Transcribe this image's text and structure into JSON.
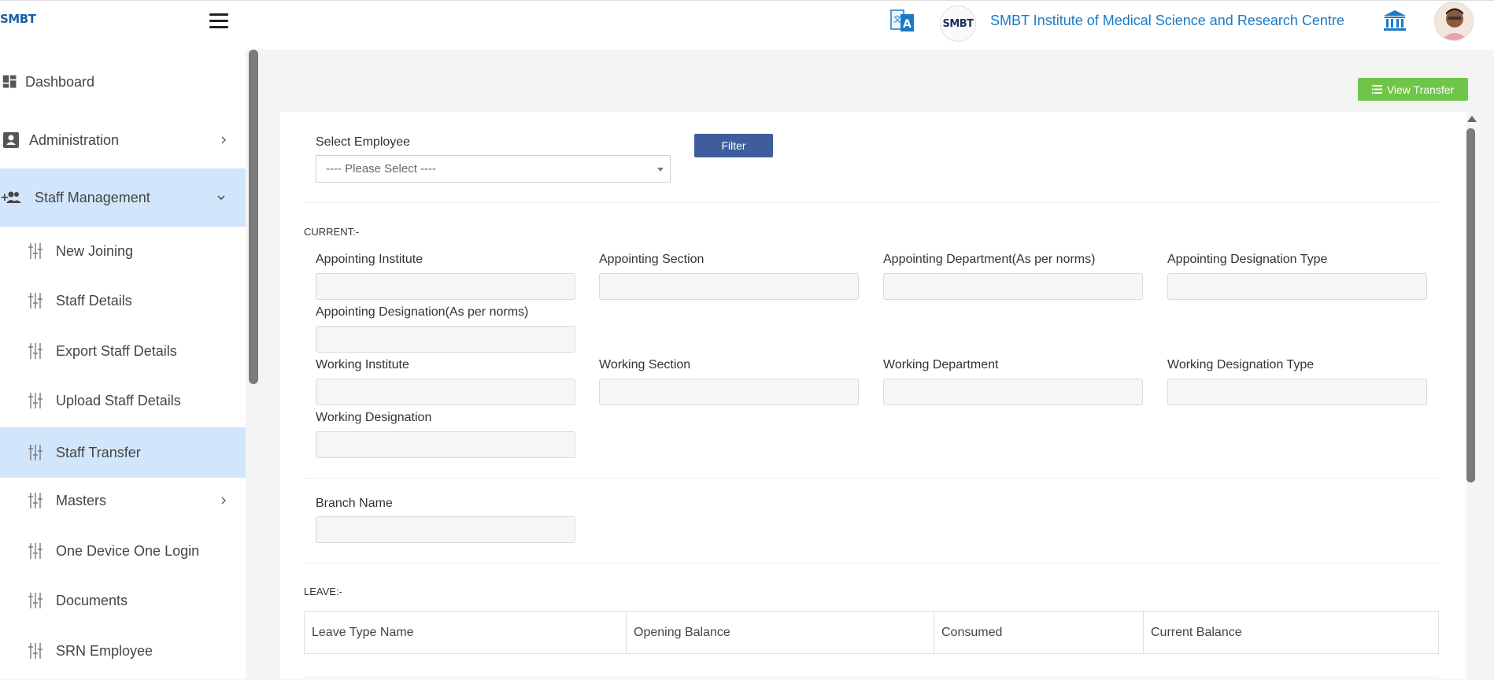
{
  "header": {
    "logo_text": "SMBT",
    "institute_logo_text": "SMBT",
    "institute_name": "SMBT Institute of Medical Science and Research Centre"
  },
  "sidebar": {
    "items": [
      {
        "label": "Dashboard",
        "icon": "dashboard-icon"
      },
      {
        "label": "Administration",
        "icon": "id-badge-icon"
      },
      {
        "label": "Staff Management",
        "icon": "people-add-icon"
      },
      {
        "label": "New Joining",
        "icon": "sliders-icon"
      },
      {
        "label": "Staff Details",
        "icon": "sliders-icon"
      },
      {
        "label": "Export Staff Details",
        "icon": "sliders-icon"
      },
      {
        "label": "Upload Staff Details",
        "icon": "sliders-icon"
      },
      {
        "label": "Staff Transfer",
        "icon": "sliders-icon"
      },
      {
        "label": "Masters",
        "icon": "sliders-icon"
      },
      {
        "label": "One Device One Login",
        "icon": "sliders-icon"
      },
      {
        "label": "Documents",
        "icon": "sliders-icon"
      },
      {
        "label": "SRN Employee",
        "icon": "sliders-icon"
      }
    ]
  },
  "actions": {
    "view_transfer": "View Transfer",
    "filter": "Filter"
  },
  "form": {
    "select_employee_label": "Select Employee",
    "select_employee_value": "---- Please Select ----",
    "current_section": "CURRENT:-",
    "appointing_institute": "Appointing Institute",
    "appointing_section": "Appointing Section",
    "appointing_department": "Appointing Department(As per norms)",
    "appointing_designation_type": "Appointing Designation Type",
    "appointing_designation": "Appointing Designation(As per norms)",
    "working_institute": "Working Institute",
    "working_section": "Working Section",
    "working_department": "Working Department",
    "working_designation_type": "Working Designation Type",
    "working_designation": "Working Designation",
    "branch_name": "Branch Name",
    "leave_section": "LEAVE:-"
  },
  "leave_table": {
    "headers": [
      "Leave Type Name",
      "Opening Balance",
      "Consumed",
      "Current Balance"
    ]
  },
  "colors": {
    "accent_blue": "#1a7ac6",
    "active_nav_bg": "#d2e6fb",
    "view_transfer_green": "#6fc548",
    "filter_button": "#3d5d9c"
  }
}
